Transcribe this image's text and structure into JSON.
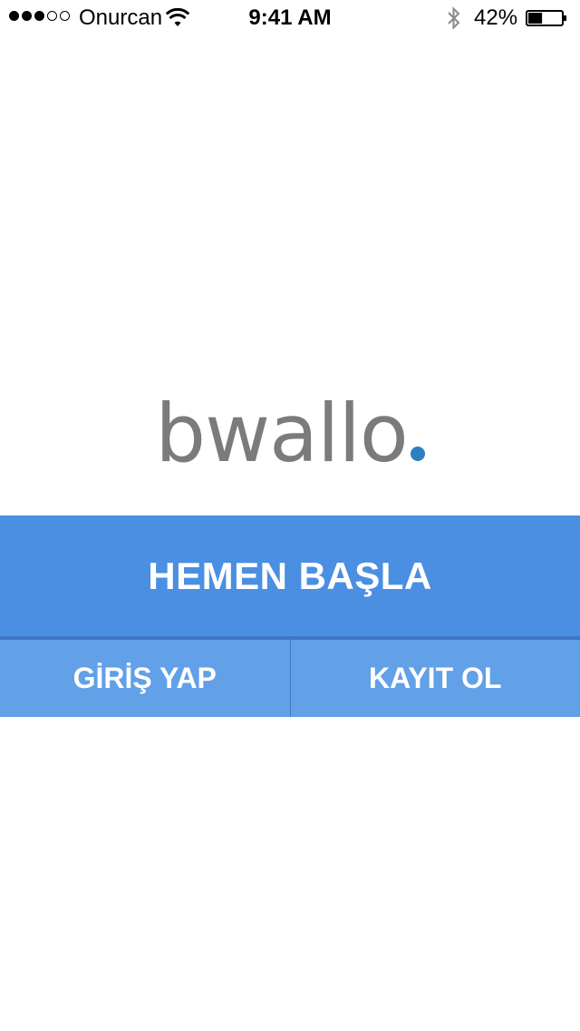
{
  "status_bar": {
    "signal_bars_filled": 3,
    "signal_bars_total": 5,
    "carrier": "Onurcan",
    "wifi_icon": "wifi-icon",
    "time": "9:41 AM",
    "bluetooth_icon": "bluetooth-icon",
    "battery_percent_label": "42%",
    "battery_level": 0.42
  },
  "logo": {
    "text": "bwallo",
    "dot_color": "#2f7ec4",
    "text_color": "#7b7b7b"
  },
  "actions": {
    "start_label": "HEMEN BAŞLA",
    "login_label": "GİRİŞ YAP",
    "register_label": "KAYIT OL"
  },
  "colors": {
    "primary": "#4a8fe2",
    "primary_dark": "#3d77c4",
    "secondary": "#62a0e8",
    "background": "#ffffff"
  }
}
